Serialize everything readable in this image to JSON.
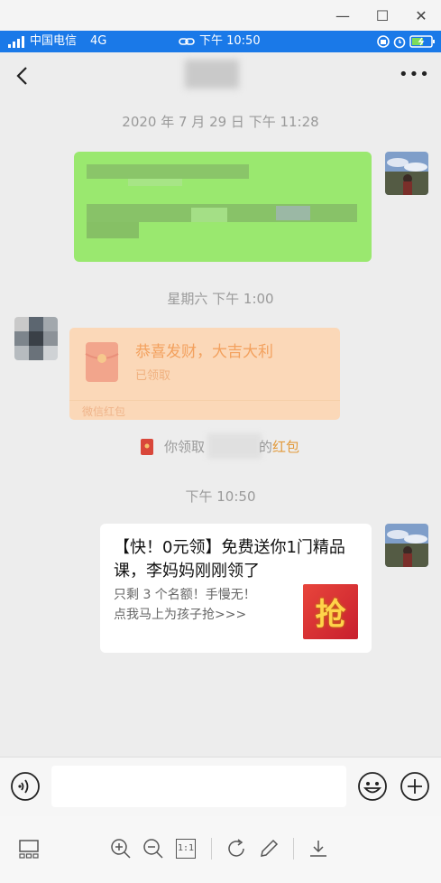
{
  "window": {
    "minimize_glyph": "—",
    "maximize_glyph": "☐",
    "close_glyph": "✕"
  },
  "status_bar": {
    "carrier": "中国电信",
    "network": "4G",
    "time": "下午 10:50",
    "colors": {
      "background": "#1a79e8"
    }
  },
  "chat": {
    "back_icon": "chevron-left-icon",
    "more_label": "•••",
    "timestamps": [
      "2020 年 7 月 29 日 下午 11:28",
      "星期六 下午 1:00",
      "下午 10:50"
    ],
    "red_packet": {
      "title": "恭喜发财，大吉大利",
      "status": "已领取",
      "footer": "微信红包",
      "icon_char": "¥"
    },
    "system_message": {
      "prefix": "你领取",
      "suffix": "的",
      "link": "红包"
    },
    "promo_card": {
      "title": "【快！0元领】免费送你1门精品课，李妈妈刚刚领了",
      "line1": "只剩 3 个名额！手慢无！",
      "line2": "点我马上为孩子抢>>>",
      "badge_char": "抢"
    }
  },
  "input_bar": {
    "voice_icon": "voice-icon",
    "emoji_icon": "emoji-icon",
    "plus_icon": "plus-icon"
  },
  "viewer_toolbar": {
    "actual_size_label": "1:1",
    "icons": [
      "thumbnail-icon",
      "zoom-in-icon",
      "zoom-out-icon",
      "actual-size-icon",
      "rotate-icon",
      "edit-icon",
      "download-icon"
    ]
  },
  "colors": {
    "accent_blue": "#1a79e8",
    "bubble_green": "#9ae86f",
    "red_packet": "#fbd8b8",
    "red_packet_text": "#e8a36b",
    "link_orange": "#e29a3b"
  }
}
